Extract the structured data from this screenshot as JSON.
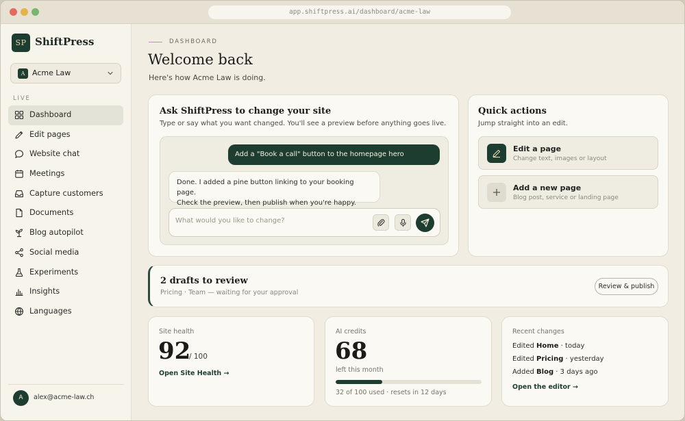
{
  "browser": {
    "url": "app.shiftpress.ai/dashboard/acme-law"
  },
  "brand": {
    "mark": "SP",
    "name": "ShiftPress"
  },
  "workspace": {
    "avatar": "A",
    "name": "Acme Law"
  },
  "sidebar": {
    "section_label": "LIVE",
    "items": [
      {
        "label": "Dashboard",
        "icon": "grid-icon",
        "active": true
      },
      {
        "label": "Edit pages",
        "icon": "pencil-icon"
      },
      {
        "label": "Website chat",
        "icon": "chat-bubble-icon"
      },
      {
        "label": "Meetings",
        "icon": "calendar-icon"
      },
      {
        "label": "Capture customers",
        "icon": "inbox-icon"
      },
      {
        "label": "Documents",
        "icon": "document-icon"
      },
      {
        "label": "Blog autopilot",
        "icon": "plant-icon"
      },
      {
        "label": "Social media",
        "icon": "share-icon"
      },
      {
        "label": "Experiments",
        "icon": "flask-icon"
      },
      {
        "label": "Insights",
        "icon": "bar-chart-icon"
      },
      {
        "label": "Languages",
        "icon": "globe-icon"
      }
    ],
    "user": {
      "avatar": "A",
      "email": "alex@acme-law.ch"
    }
  },
  "header": {
    "eyebrow": "DASHBOARD",
    "title": "Welcome back",
    "subtitle": "Here's how Acme Law is doing."
  },
  "ask": {
    "title": "Ask ShiftPress to change your site",
    "subtitle": "Type or say what you want changed. You'll see a preview before anything goes live.",
    "user_message": "Add a \"Book a call\" button to the homepage hero",
    "ai_message_line1": "Done. I added a pine button linking to your booking page.",
    "ai_message_line2": "Check the preview, then publish when you're happy.",
    "input_placeholder": "What would you like to change?"
  },
  "quick_actions": {
    "title": "Quick actions",
    "subtitle": "Jump straight into an edit.",
    "items": [
      {
        "title": "Edit a page",
        "subtitle": "Change text, images or layout",
        "icon": "pencil-icon"
      },
      {
        "title": "Add a new page",
        "subtitle": "Blog post, service or landing page",
        "icon": "plus-icon"
      }
    ]
  },
  "drafts": {
    "title": "2 drafts to review",
    "subtitle": "Pricing · Team — waiting for your approval",
    "button": "Review & publish"
  },
  "site_health": {
    "label": "Site health",
    "value": "92",
    "suffix": "/ 100",
    "link": "Open Site Health →"
  },
  "credits": {
    "label": "AI credits",
    "value": "68",
    "sub": "left this month",
    "used_fraction": 0.32,
    "meta": "32 of 100 used · resets in 12 days"
  },
  "recent": {
    "label": "Recent changes",
    "rows": [
      {
        "prefix": "Edited ",
        "target": "Home",
        "suffix": " · today"
      },
      {
        "prefix": "Edited ",
        "target": "Pricing",
        "suffix": " · yesterday"
      },
      {
        "prefix": "Added ",
        "target": "Blog",
        "suffix": " · 3 days ago"
      }
    ],
    "link": "Open the editor →"
  },
  "colors": {
    "accent": "#1e3d31",
    "background": "#f1ede3",
    "gold": "#c69b5b"
  }
}
